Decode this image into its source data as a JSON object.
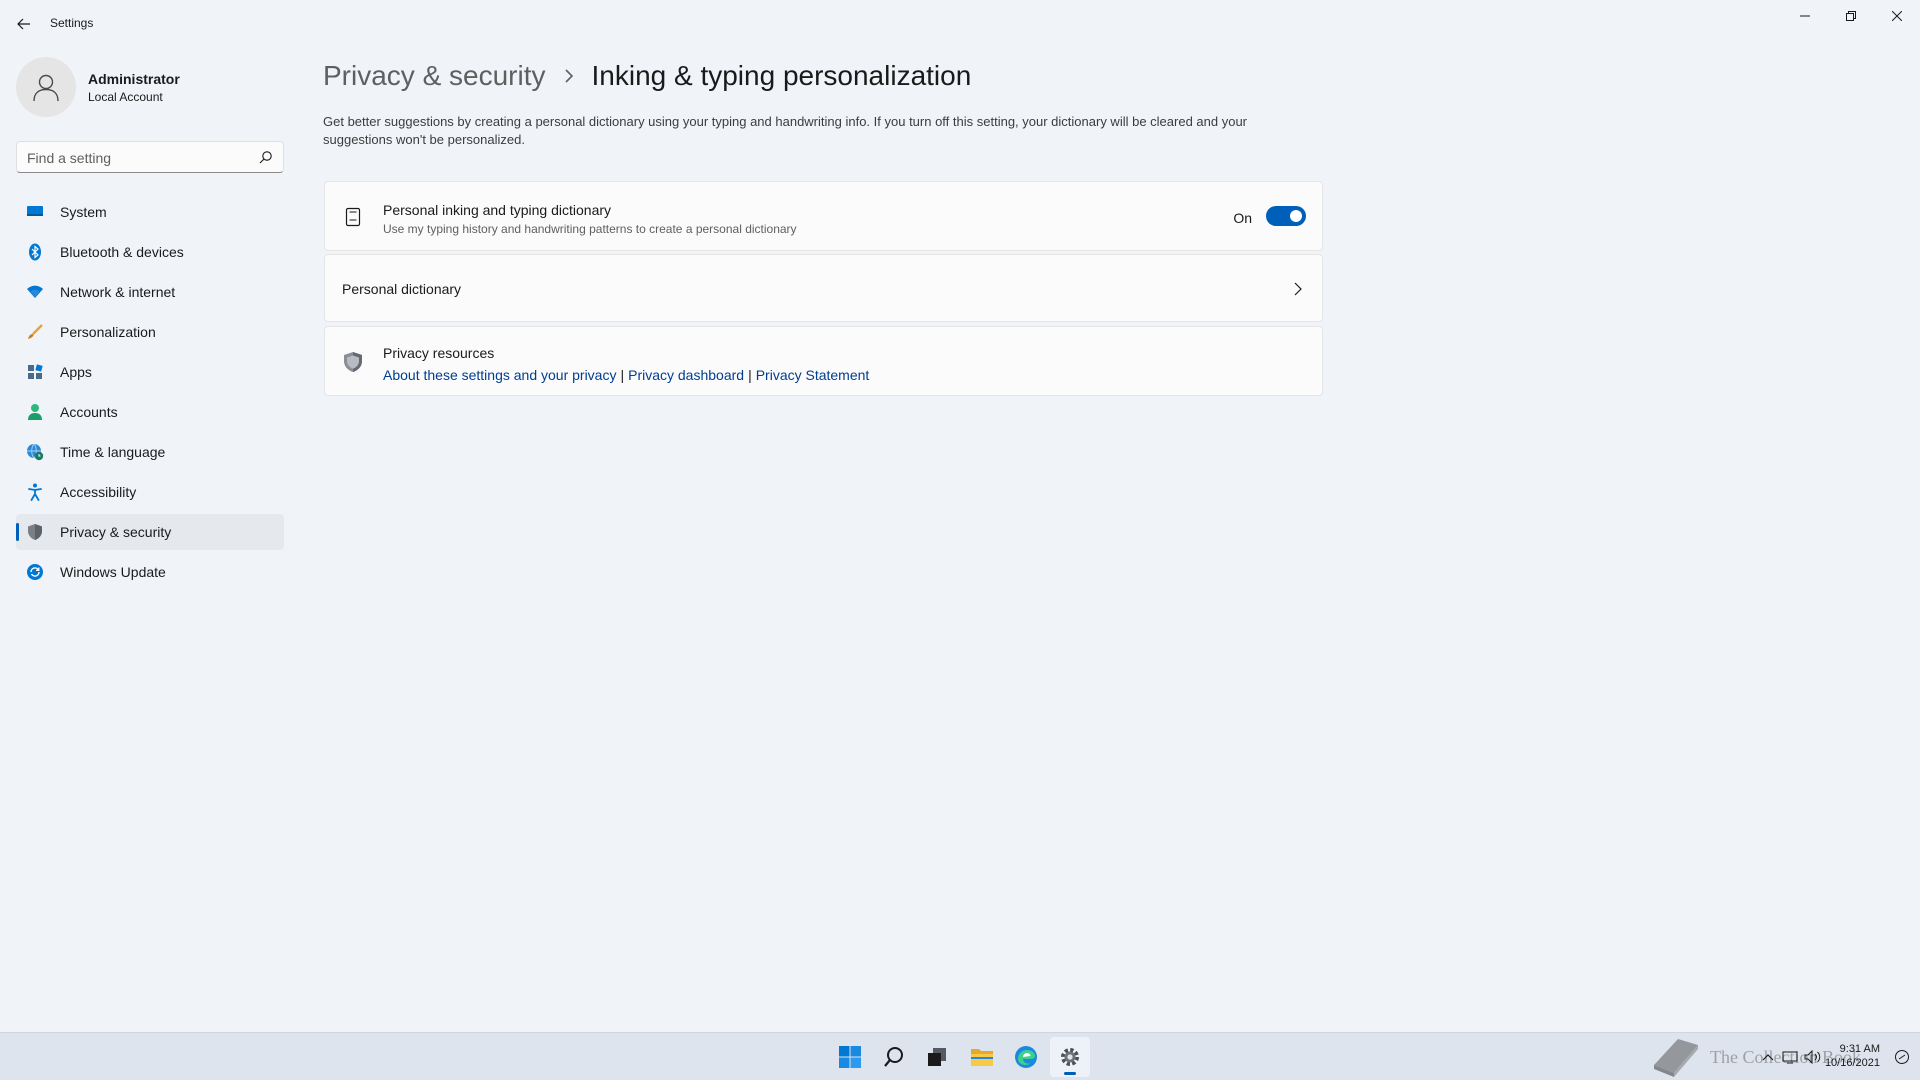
{
  "window": {
    "title": "Settings",
    "back_icon": "back-arrow-icon",
    "controls": [
      "minimize-icon",
      "restore-icon",
      "close-icon"
    ]
  },
  "profile": {
    "name": "Administrator",
    "account_type": "Local Account",
    "avatar_icon": "user-icon"
  },
  "search": {
    "placeholder": "Find a setting",
    "value": "",
    "icon": "search-icon"
  },
  "sidebar": {
    "items": [
      {
        "label": "System",
        "icon": "system-icon",
        "active": false
      },
      {
        "label": "Bluetooth & devices",
        "icon": "bluetooth-icon",
        "active": false
      },
      {
        "label": "Network & internet",
        "icon": "wifi-icon",
        "active": false
      },
      {
        "label": "Personalization",
        "icon": "brush-icon",
        "active": false
      },
      {
        "label": "Apps",
        "icon": "apps-icon",
        "active": false
      },
      {
        "label": "Accounts",
        "icon": "accounts-icon",
        "active": false
      },
      {
        "label": "Time & language",
        "icon": "globe-clock-icon",
        "active": false
      },
      {
        "label": "Accessibility",
        "icon": "accessibility-icon",
        "active": false
      },
      {
        "label": "Privacy & security",
        "icon": "shield-icon",
        "active": true
      },
      {
        "label": "Windows Update",
        "icon": "update-icon",
        "active": false
      }
    ]
  },
  "breadcrumb": {
    "parent": "Privacy & security",
    "current": "Inking & typing personalization"
  },
  "description": "Get better suggestions by creating a personal dictionary using your typing and handwriting info. If you turn off this setting, your dictionary will be cleared and your suggestions won't be personalized.",
  "cards": {
    "dictionary_toggle": {
      "title": "Personal inking and typing dictionary",
      "subtitle": "Use my typing history and handwriting patterns to create a personal dictionary",
      "state_label": "On",
      "enabled": true,
      "icon": "notepad-icon"
    },
    "personal_dictionary": {
      "title": "Personal dictionary",
      "icon": "chevron-right-icon"
    },
    "privacy_resources": {
      "title": "Privacy resources",
      "icon": "shield-icon",
      "links": [
        "About these settings and your privacy",
        "Privacy dashboard",
        "Privacy Statement"
      ],
      "separator": "|"
    }
  },
  "taskbar": {
    "apps": [
      "start-icon",
      "search-icon",
      "task-view-icon",
      "file-explorer-icon",
      "edge-icon",
      "settings-icon"
    ],
    "active_app": "settings-icon",
    "time": "9:31 AM",
    "date": "10/16/2021",
    "watermark": "The Collection Book"
  },
  "colors": {
    "accent": "#005fb8",
    "background": "#f0f4f9",
    "card": "#fbfbfb",
    "link": "#003e92"
  }
}
